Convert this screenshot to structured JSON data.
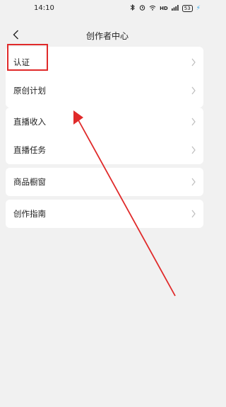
{
  "status_bar": {
    "time": "14:10",
    "icons": [
      "bluetooth-icon",
      "alarm-icon",
      "wifi-icon",
      "hd-icon",
      "signal-icon",
      "battery-icon"
    ],
    "hd_label": "HD",
    "battery_label": "53"
  },
  "header": {
    "title": "创作者中心"
  },
  "menu": {
    "group1": [
      {
        "label": "认证"
      },
      {
        "label": "原创计划"
      }
    ],
    "group2": [
      {
        "label": "直播收入"
      },
      {
        "label": "直播任务"
      }
    ],
    "group3": [
      {
        "label": "商品橱窗"
      }
    ],
    "group4": [
      {
        "label": "创作指南"
      }
    ]
  },
  "colors": {
    "background": "#f1f1f1",
    "card": "#ffffff",
    "annotation": "#e02a2a",
    "charge": "#2fa3e6"
  }
}
